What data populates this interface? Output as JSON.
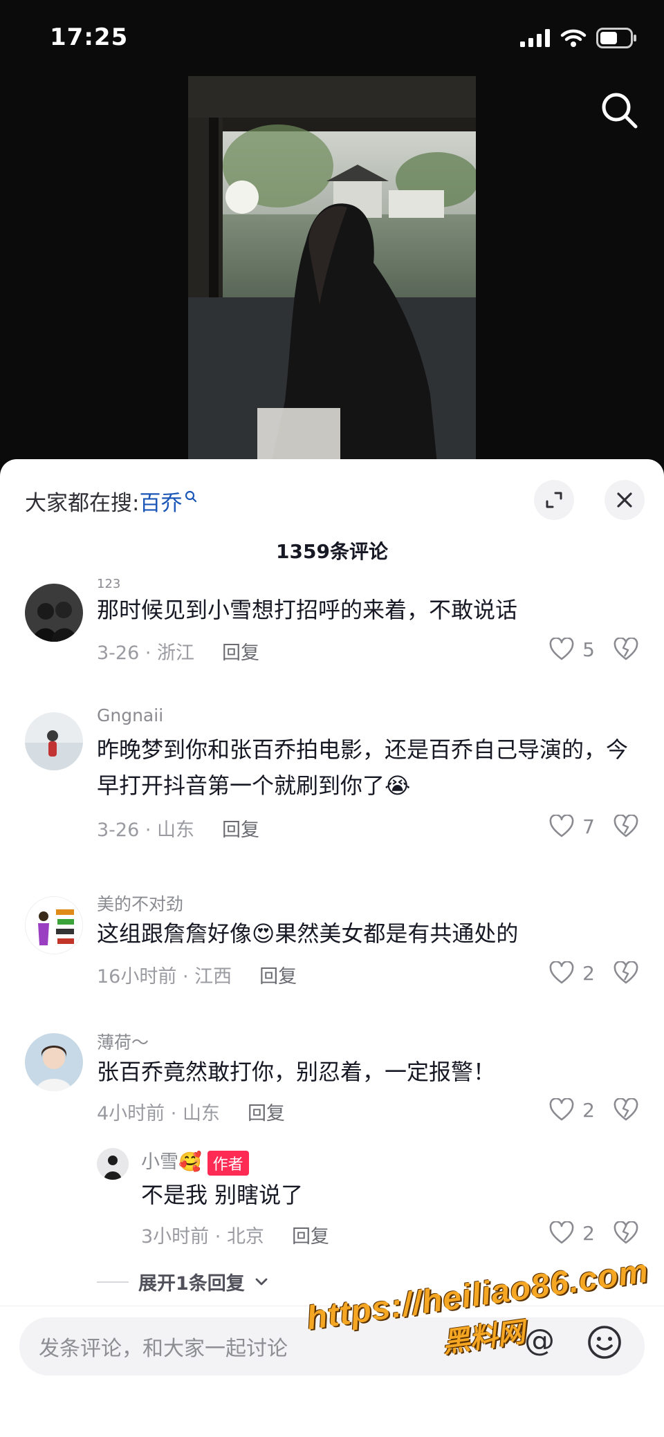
{
  "status_bar": {
    "time": "17:25"
  },
  "sheet": {
    "hot_search_prefix": "大家都在搜:",
    "hot_search_keyword": "百乔",
    "comment_count": "1359条评论"
  },
  "comments": [
    {
      "user": "123",
      "text": "那时候见到小雪想打招呼的来着，不敢说话",
      "date": "3-26",
      "location": "浙江",
      "reply_label": "回复",
      "likes": "5"
    },
    {
      "user": "Gngnaii",
      "text": "昨晚梦到你和张百乔拍电影，还是百乔自己导演的，今早打开抖音第一个就刷到你了😭",
      "date": "3-26",
      "location": "山东",
      "reply_label": "回复",
      "likes": "7"
    },
    {
      "user": "美的不对劲",
      "text": "这组跟詹詹好像😍果然美女都是有共通处的",
      "date": "16小时前",
      "location": "江西",
      "reply_label": "回复",
      "likes": "2"
    },
    {
      "user": "薄荷～",
      "text": "张百乔竟然敢打你，别忍着，一定报警！",
      "date": "4小时前",
      "location": "山东",
      "reply_label": "回复",
      "likes": "2"
    }
  ],
  "reply": {
    "user": "小雪🥰",
    "badge": "作者",
    "text": "不是我 别瞎说了",
    "date": "3小时前",
    "location": "北京",
    "reply_label": "回复",
    "likes": "2"
  },
  "expand_replies": "展开1条回复",
  "input": {
    "placeholder": "发条评论，和大家一起讨论"
  },
  "watermark": {
    "url": "https://heiliao86.com",
    "name": "黑料网"
  },
  "colors": {
    "accent": "#fe2c55",
    "link": "#1a56b8",
    "watermark": "#f5a623"
  },
  "icons": [
    "signal-icon",
    "wifi-icon",
    "battery-icon",
    "search-icon",
    "expand-icon",
    "close-icon",
    "heart-icon",
    "broken-heart-icon",
    "at-icon",
    "emoji-icon"
  ]
}
